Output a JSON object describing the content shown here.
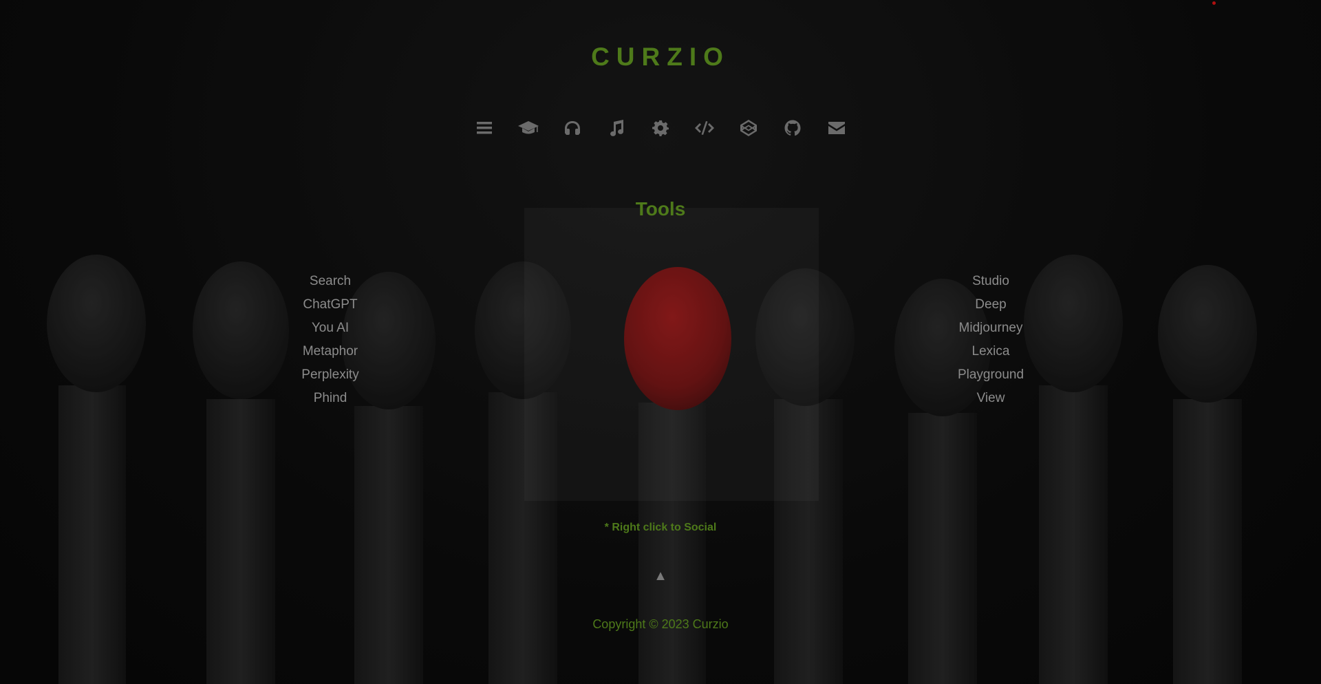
{
  "header": {
    "title": "CURZIO"
  },
  "nav": {
    "items": [
      {
        "icon": "menu-icon"
      },
      {
        "icon": "graduation-cap-icon"
      },
      {
        "icon": "headphones-icon"
      },
      {
        "icon": "music-icon"
      },
      {
        "icon": "gear-icon"
      },
      {
        "icon": "code-icon"
      },
      {
        "icon": "codepen-icon"
      },
      {
        "icon": "github-icon"
      },
      {
        "icon": "envelope-icon"
      }
    ]
  },
  "main": {
    "section_title": "Tools",
    "left_links": [
      "Search",
      "ChatGPT",
      "You AI",
      "Metaphor",
      "Perplexity",
      "Phind"
    ],
    "right_links": [
      "Studio",
      "Deep",
      "Midjourney",
      "Lexica",
      "Playground",
      "View"
    ],
    "hint": "* Right click to Social",
    "back_to_top": "▲"
  },
  "footer": {
    "copyright": "Copyright © 2023 Curzio"
  },
  "colors": {
    "accent": "#4e7a1a",
    "link": "#8c8c8c",
    "icon": "#6b6b6b",
    "match_head_highlight": "#9a1414",
    "background": "#0b0b0b"
  }
}
